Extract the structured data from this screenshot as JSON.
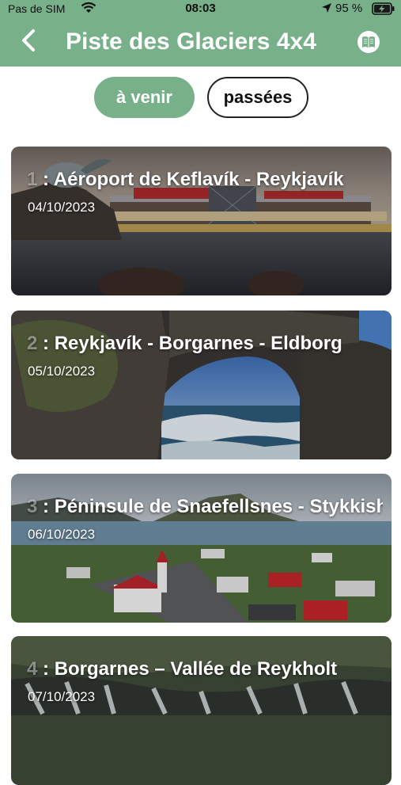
{
  "status_bar": {
    "carrier": "Pas de SIM",
    "time": "08:03",
    "battery": "95 %"
  },
  "header": {
    "title": "Piste des Glaciers 4x4",
    "back_icon": "chevron-left-icon",
    "book_icon": "book-icon",
    "bg_color": "#78b08a"
  },
  "tabs": {
    "upcoming": "à venir",
    "past": "passées"
  },
  "stages": [
    {
      "number": "1",
      "title": " : Aéroport de Keflavík - Reykjavík",
      "date": "04/10/2023"
    },
    {
      "number": "2",
      "title": " : Reykjavík - Borgarnes - Eldborg",
      "date": "05/10/2023"
    },
    {
      "number": "3",
      "title": " : Péninsule de Snaefellsnes - Stykkishólmur",
      "date": "06/10/2023"
    },
    {
      "number": "4",
      "title": " : Borgarnes – Vallée de Reykholt",
      "date": "07/10/2023"
    }
  ]
}
